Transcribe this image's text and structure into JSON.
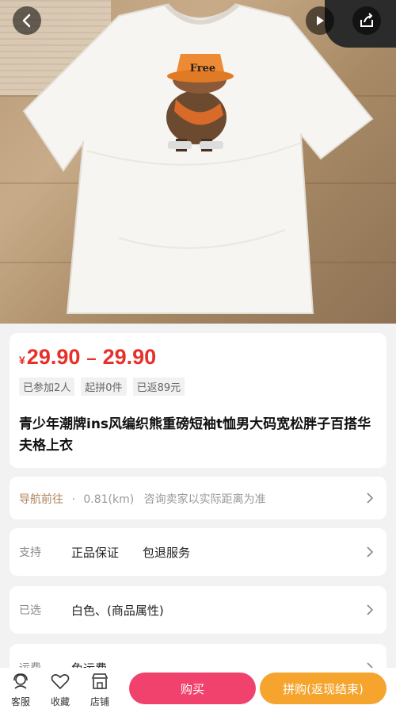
{
  "hero": {
    "hat_text": "Free",
    "back_icon": "chevron-left-icon",
    "play_icon": "play-icon",
    "share_icon": "share-icon"
  },
  "price": {
    "symbol": "¥",
    "low": "29.90",
    "dash": "–",
    "high": "29.90",
    "color": "#e8302a"
  },
  "tags": [
    "已参加2人",
    "起拼0件",
    "已返89元"
  ],
  "product_title": "青少年潮牌ins风编织熊重磅短袖t恤男大码宽松胖子百搭华夫格上衣",
  "nav": {
    "label": "导航前往",
    "dot": "·",
    "distance": "0.81(km)",
    "note": "咨询卖家以实际距离为准"
  },
  "service": {
    "label": "支持",
    "item1": "正品保证",
    "item2": "包退服务"
  },
  "selected": {
    "label": "已选",
    "value": "白色、(商品属性)"
  },
  "freight": {
    "label": "运费",
    "value": "免运费"
  },
  "bottom": {
    "service_label": "客服",
    "favorite_label": "收藏",
    "shop_label": "店铺",
    "buy_label": "购买",
    "group_label": "拼购(返现结束)",
    "buy_color": "#f0426d",
    "group_color": "#f5a42e"
  }
}
